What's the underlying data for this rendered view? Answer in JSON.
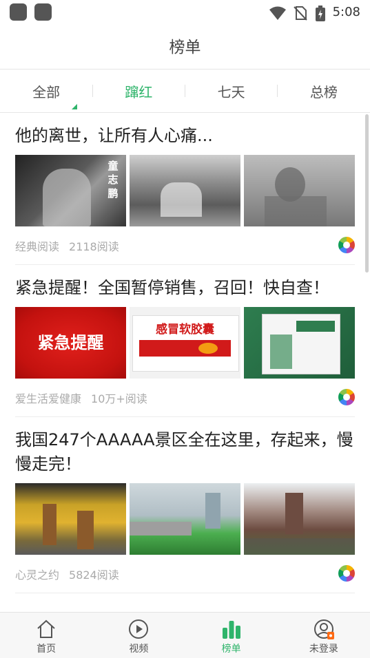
{
  "status": {
    "time": "5:08"
  },
  "header": {
    "title": "榜单"
  },
  "tabs": [
    {
      "label": "全部"
    },
    {
      "label": "蹿红"
    },
    {
      "label": "七天"
    },
    {
      "label": "总榜"
    }
  ],
  "articles": [
    {
      "title": "他的离世，让所有人心痛...",
      "source": "经典阅读",
      "reads": "2118阅读",
      "image_text": [
        "童志鹏"
      ]
    },
    {
      "title": "紧急提醒！全国暂停销售，召回！快自查！",
      "source": "爱生活爱健康",
      "reads": "10万+阅读",
      "image_text": [
        "紧急提醒",
        "感冒软胶囊"
      ]
    },
    {
      "title": "我国247个AAAAA景区全在这里，存起来，慢慢走完！",
      "source": "心灵之约",
      "reads": "5824阅读",
      "image_text": []
    }
  ],
  "nav": [
    {
      "label": "首页",
      "icon": "home-icon"
    },
    {
      "label": "视频",
      "icon": "play-icon"
    },
    {
      "label": "榜单",
      "icon": "chart-icon"
    },
    {
      "label": "未登录",
      "icon": "user-icon"
    }
  ],
  "colors": {
    "accent": "#2fb46b"
  }
}
